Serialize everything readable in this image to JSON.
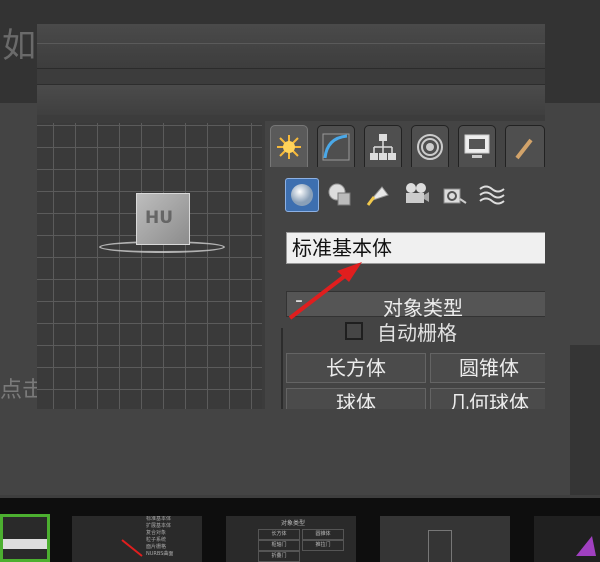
{
  "background": {
    "title_fragment": "如",
    "side_text": "点击"
  },
  "viewport": {
    "cube_label": "HU"
  },
  "panel": {
    "tabs": [
      {
        "name": "create-tab",
        "icon": "sun-star-icon"
      },
      {
        "name": "modify-tab",
        "icon": "curve-icon"
      },
      {
        "name": "hierarchy-tab",
        "icon": "hierarchy-icon"
      },
      {
        "name": "motion-tab",
        "icon": "target-icon"
      },
      {
        "name": "display-tab",
        "icon": "monitor-icon"
      },
      {
        "name": "utilities-tab",
        "icon": "hammer-icon"
      }
    ],
    "category_icons": [
      {
        "name": "geometry-icon",
        "selected": true
      },
      {
        "name": "shapes-icon",
        "selected": false
      },
      {
        "name": "lights-icon",
        "selected": false
      },
      {
        "name": "cameras-icon",
        "selected": false
      },
      {
        "name": "helpers-icon",
        "selected": false
      },
      {
        "name": "space-warps-icon",
        "selected": false
      }
    ],
    "dropdown_value": "标准基本体",
    "rollout_minus": "-",
    "rollout_title": "对象类型",
    "auto_grid_label": "自动栅格",
    "buttons": {
      "box": "长方体",
      "cone": "圆锥体",
      "sphere": "球体",
      "geosphere": "几何球体"
    }
  },
  "colors": {
    "accent_selected": "#3d6fb0",
    "annotation_arrow": "#e01e1e",
    "thumb_highlight": "#4caf30"
  },
  "thumbnails": {
    "t2_lines": [
      "标准基本体",
      "扩展基本体",
      "复合对象",
      "粒子系统",
      "面片栅格",
      "NURBS曲面"
    ],
    "t3_title": "对象类型",
    "t3_buttons": [
      "长方体",
      "圆锥体",
      "枢轴门",
      "推拉门",
      "折叠门"
    ]
  }
}
